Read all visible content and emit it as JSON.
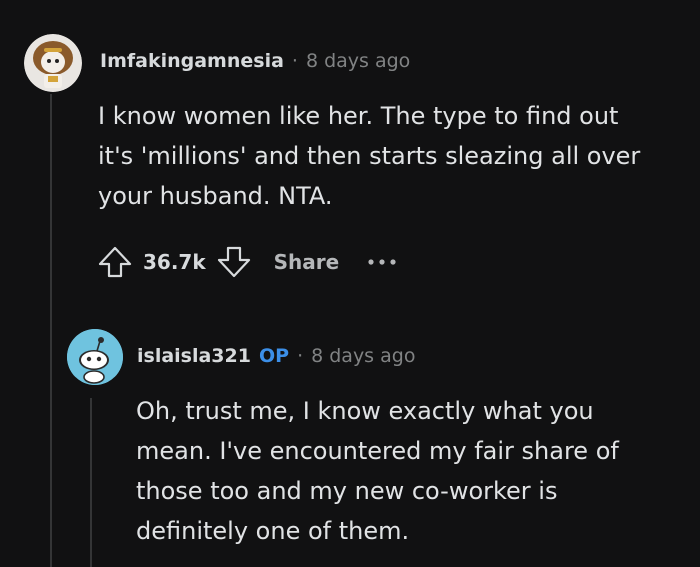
{
  "comment": {
    "username": "Imfakingamnesia",
    "separator": "·",
    "time": "8 days ago",
    "body": [
      "I know women like her. The type to find out",
      "it's 'millions' and then starts sleazing all over",
      "your husband. NTA."
    ],
    "votes": "36.7k",
    "share_label": "Share"
  },
  "reply": {
    "username": "islaisla321",
    "op_badge": "OP",
    "separator": "·",
    "time": "8 days ago",
    "body": [
      "Oh, trust me, I know exactly what you",
      "mean. I've encountered my fair share of",
      "those too and my new co-worker is",
      "definitely one of them."
    ]
  },
  "colors": {
    "background": "#111112",
    "op_badge": "#3c8fe8",
    "reply_avatar_bg": "#6fc3df"
  },
  "icons": [
    "upvote-icon",
    "downvote-icon",
    "more-options-icon",
    "user-avatar",
    "snoo-avatar"
  ]
}
